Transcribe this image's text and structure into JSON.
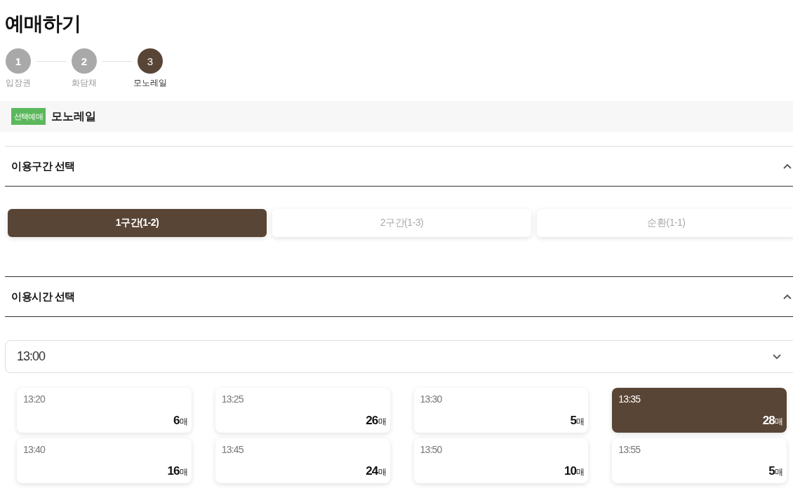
{
  "page": {
    "title": "예매하기"
  },
  "steps": [
    {
      "number": "1",
      "label": "입장권",
      "selected": false
    },
    {
      "number": "2",
      "label": "화담채",
      "selected": false
    },
    {
      "number": "3",
      "label": "모노레일",
      "selected": true
    }
  ],
  "selection": {
    "badge": "선택예매",
    "name": "모노레일"
  },
  "route_section": {
    "title": "이용구간 선택",
    "expanded": true,
    "routes": [
      {
        "label": "1구간(1-2)",
        "selected": true
      },
      {
        "label": "2구간(1-3)",
        "selected": false
      },
      {
        "label": "순환(1-1)",
        "selected": false
      }
    ]
  },
  "time_section": {
    "title": "이용시간 선택",
    "expanded": true,
    "hour_select": {
      "value": "13:00"
    },
    "slots": [
      {
        "time": "13:20",
        "count": "6",
        "unit": "매",
        "selected": false
      },
      {
        "time": "13:25",
        "count": "26",
        "unit": "매",
        "selected": false
      },
      {
        "time": "13:30",
        "count": "5",
        "unit": "매",
        "selected": false
      },
      {
        "time": "13:35",
        "count": "28",
        "unit": "매",
        "selected": true
      },
      {
        "time": "13:40",
        "count": "16",
        "unit": "매",
        "selected": false
      },
      {
        "time": "13:45",
        "count": "24",
        "unit": "매",
        "selected": false
      },
      {
        "time": "13:50",
        "count": "10",
        "unit": "매",
        "selected": false
      },
      {
        "time": "13:55",
        "count": "5",
        "unit": "매",
        "selected": false
      }
    ]
  }
}
